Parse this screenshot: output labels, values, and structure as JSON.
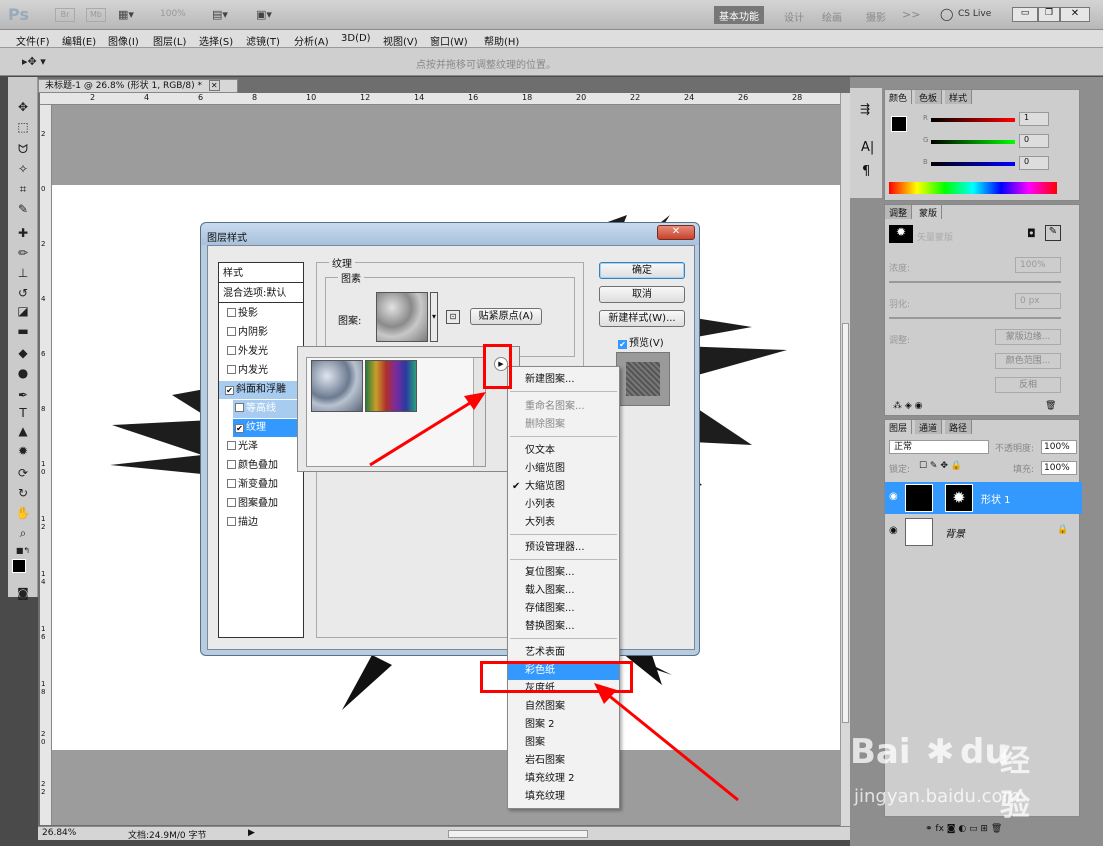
{
  "titlebar": {
    "app_logo": "Ps",
    "br": "Br",
    "mb": "Mb",
    "zoom": "100%",
    "workspace_active": "基本功能",
    "workspaces": [
      "设计",
      "绘画",
      "摄影"
    ],
    "more": ">>",
    "cslive": "CS Live"
  },
  "menu": [
    "文件(F)",
    "编辑(E)",
    "图像(I)",
    "图层(L)",
    "选择(S)",
    "滤镜(T)",
    "分析(A)",
    "3D(D)",
    "视图(V)",
    "窗口(W)",
    "帮助(H)"
  ],
  "options": {
    "hint": "点按并拖移可调整纹理的位置。"
  },
  "document": {
    "tab_title": "未标题-1 @ 26.8% (形状 1, RGB/8) *",
    "ruler_labels": [
      "2",
      "4",
      "6",
      "8",
      "10",
      "12",
      "14",
      "16",
      "18",
      "20",
      "22",
      "24",
      "26",
      "28"
    ],
    "vruler_labels": [
      "2",
      "0",
      "2",
      "4",
      "6",
      "8",
      "1 0",
      "1 2",
      "1 4",
      "1 6",
      "1 8",
      "2 0",
      "2 2",
      "2 4"
    ],
    "status_zoom": "26.84%",
    "status_doc": "文档:24.9M/0 字节"
  },
  "dialog": {
    "title": "图层样式",
    "styles_header": "样式",
    "blend": "混合选项:默认",
    "effects": [
      {
        "label": "投影",
        "checked": false
      },
      {
        "label": "内阴影",
        "checked": false
      },
      {
        "label": "外发光",
        "checked": false
      },
      {
        "label": "内发光",
        "checked": false
      },
      {
        "label": "斜面和浮雕",
        "checked": true
      },
      {
        "label": "等高线",
        "checked": false
      },
      {
        "label": "纹理",
        "checked": true
      },
      {
        "label": "光泽",
        "checked": false
      },
      {
        "label": "颜色叠加",
        "checked": false
      },
      {
        "label": "渐变叠加",
        "checked": false
      },
      {
        "label": "图案叠加",
        "checked": false
      },
      {
        "label": "描边",
        "checked": false
      }
    ],
    "group_title": "纹理",
    "sub_group": "图素",
    "pattern_label": "图案:",
    "snap_btn": "贴紧原点(A)",
    "ok": "确定",
    "cancel": "取消",
    "new_style": "新建样式(W)...",
    "preview": "预览(V)"
  },
  "context_menu": [
    {
      "label": "新建图案...",
      "state": "normal"
    },
    {
      "label": "sep"
    },
    {
      "label": "重命名图案...",
      "state": "disabled"
    },
    {
      "label": "删除图案",
      "state": "disabled"
    },
    {
      "label": "sep"
    },
    {
      "label": "仅文本",
      "state": "normal"
    },
    {
      "label": "小缩览图",
      "state": "normal"
    },
    {
      "label": "大缩览图",
      "state": "checked"
    },
    {
      "label": "小列表",
      "state": "normal"
    },
    {
      "label": "大列表",
      "state": "normal"
    },
    {
      "label": "sep"
    },
    {
      "label": "预设管理器...",
      "state": "normal"
    },
    {
      "label": "sep"
    },
    {
      "label": "复位图案...",
      "state": "normal"
    },
    {
      "label": "载入图案...",
      "state": "normal"
    },
    {
      "label": "存储图案...",
      "state": "normal"
    },
    {
      "label": "替换图案...",
      "state": "normal"
    },
    {
      "label": "sep"
    },
    {
      "label": "艺术表面",
      "state": "normal"
    },
    {
      "label": "彩色纸",
      "state": "selected"
    },
    {
      "label": "灰度纸",
      "state": "normal"
    },
    {
      "label": "自然图案",
      "state": "normal"
    },
    {
      "label": "图案 2",
      "state": "normal"
    },
    {
      "label": "图案",
      "state": "normal"
    },
    {
      "label": "岩石图案",
      "state": "normal"
    },
    {
      "label": "填充纹理 2",
      "state": "normal"
    },
    {
      "label": "填充纹理",
      "state": "normal"
    }
  ],
  "color_panel": {
    "tabs": [
      "颜色",
      "色板",
      "样式"
    ],
    "r_label": "R",
    "g_label": "G",
    "b_label": "B",
    "r": "1",
    "g": "0",
    "b": "0"
  },
  "adjust_panel": {
    "tabs": [
      "调整",
      "蒙版"
    ],
    "mask_title": "矢量蒙版",
    "density_label": "浓度:",
    "density": "100%",
    "feather_label": "羽化:",
    "feather": "0 px",
    "refine_label": "调整:",
    "btn_edge": "蒙版边缘...",
    "btn_range": "颜色范围...",
    "btn_invert": "反相"
  },
  "layers_panel": {
    "tabs": [
      "图层",
      "通道",
      "路径"
    ],
    "blend_mode": "正常",
    "opacity_label": "不透明度:",
    "opacity": "100%",
    "lock_label": "锁定:",
    "fill_label": "填充:",
    "fill": "100%",
    "layers": [
      {
        "name": "形状 1",
        "selected": true
      },
      {
        "name": "背景",
        "selected": false
      }
    ]
  },
  "watermark": {
    "brand": "Bai",
    "brand2": "du",
    "cn": "经验",
    "url": "jingyan.baidu.com"
  },
  "colors": {
    "accent": "#3399ff",
    "red": "#ff0000",
    "dialog_frame": "#b8cce0"
  }
}
